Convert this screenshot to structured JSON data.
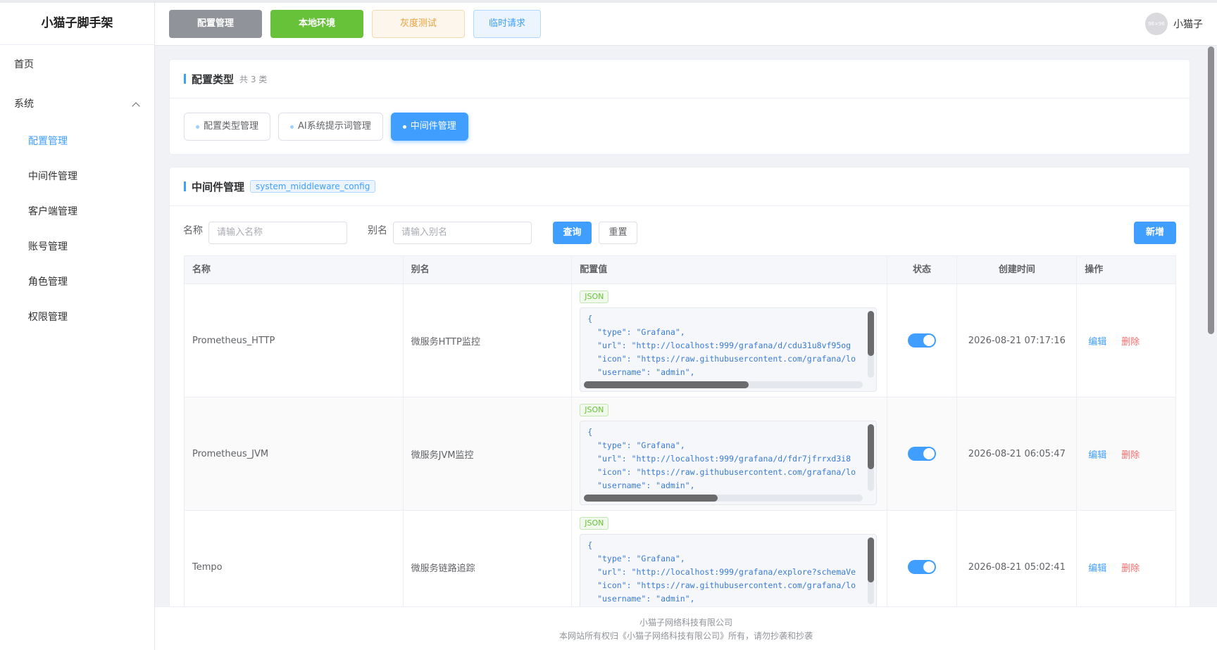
{
  "app": {
    "title": "小猫子脚手架"
  },
  "sidebar": {
    "home": "首页",
    "system": "系统",
    "items": [
      {
        "label": "配置管理"
      },
      {
        "label": "中间件管理"
      },
      {
        "label": "客户端管理"
      },
      {
        "label": "账号管理"
      },
      {
        "label": "角色管理"
      },
      {
        "label": "权限管理"
      }
    ]
  },
  "header": {
    "env_buttons": [
      "配置管理",
      "本地环境",
      "灰度测试",
      "临时请求"
    ],
    "user_name": "小猫子",
    "avatar_text": "96×96"
  },
  "config_types": {
    "title": "配置类型",
    "count": "共 3 类",
    "tabs": [
      "配置类型管理",
      "AI系统提示词管理",
      "中间件管理"
    ]
  },
  "middleware": {
    "title": "中间件管理",
    "tag": "system_middleware_config",
    "search": {
      "name_label": "名称",
      "name_placeholder": "请输入名称",
      "alias_label": "别名",
      "alias_placeholder": "请输入别名",
      "query_button": "查询",
      "reset_button": "重置",
      "add_button": "新增"
    },
    "columns": [
      "名称",
      "别名",
      "配置值",
      "状态",
      "创建时间",
      "操作"
    ],
    "rows": [
      {
        "name": "Prometheus_HTTP",
        "alias": "微服务HTTP监控",
        "badge": "JSON",
        "config": "{\n  \"type\": \"Grafana\",\n  \"url\": \"http://localhost:999/grafana/d/cdu31u8vf95og\n  \"icon\": \"https://raw.githubusercontent.com/grafana/lo\n  \"username\": \"admin\",",
        "created": "2026-08-21 07:17:16",
        "scroll_h": 0.59,
        "edit": "编辑",
        "delete": "删除"
      },
      {
        "name": "Prometheus_JVM",
        "alias": "微服务JVM监控",
        "badge": "JSON",
        "config": "{\n  \"type\": \"Grafana\",\n  \"url\": \"http://localhost:999/grafana/d/fdr7jfrrxd3i8\n  \"icon\": \"https://raw.githubusercontent.com/grafana/lo\n  \"username\": \"admin\",",
        "created": "2026-08-21 06:05:47",
        "scroll_h": 0.48,
        "edit": "编辑",
        "delete": "删除"
      },
      {
        "name": "Tempo",
        "alias": "微服务链路追踪",
        "badge": "JSON",
        "config": "{\n  \"type\": \"Grafana\",\n  \"url\": \"http://localhost:999/grafana/explore?schemaVe\n  \"icon\": \"https://raw.githubusercontent.com/grafana/lo\n  \"username\": \"admin\",",
        "created": "2026-08-21 05:02:41",
        "scroll_h": 0.14,
        "edit": "编辑",
        "delete": "删除"
      }
    ]
  },
  "footer": {
    "company": "小猫子网络科技有限公司",
    "copyright": "本网站所有权归《小猫子网络科技有限公司》所有，请勿抄袭和抄袭"
  },
  "colors": {
    "primary": "#409eff",
    "success": "#67c23a",
    "warning": "#e6a23c",
    "danger": "#f56c6c",
    "info": "#909399"
  },
  "icons": {
    "system_chevron": "chevron-up-icon"
  }
}
